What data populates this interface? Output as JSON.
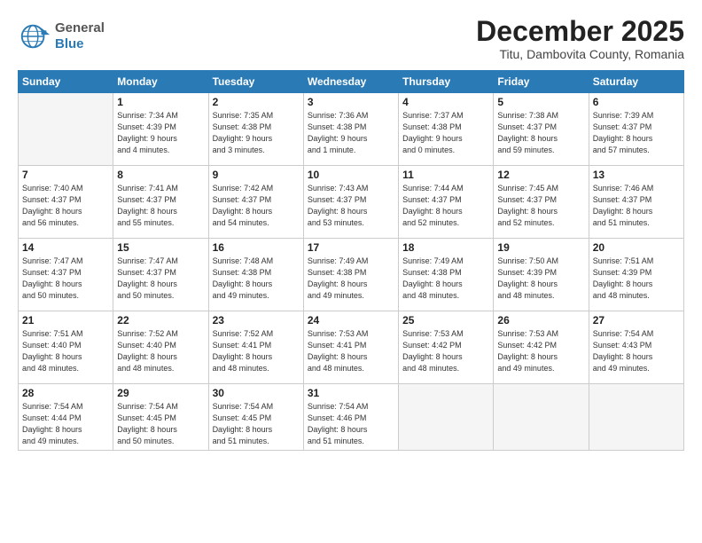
{
  "logo": {
    "general": "General",
    "blue": "Blue"
  },
  "title": "December 2025",
  "subtitle": "Titu, Dambovita County, Romania",
  "days_of_week": [
    "Sunday",
    "Monday",
    "Tuesday",
    "Wednesday",
    "Thursday",
    "Friday",
    "Saturday"
  ],
  "weeks": [
    [
      {
        "day": "",
        "info": ""
      },
      {
        "day": "1",
        "info": "Sunrise: 7:34 AM\nSunset: 4:39 PM\nDaylight: 9 hours\nand 4 minutes."
      },
      {
        "day": "2",
        "info": "Sunrise: 7:35 AM\nSunset: 4:38 PM\nDaylight: 9 hours\nand 3 minutes."
      },
      {
        "day": "3",
        "info": "Sunrise: 7:36 AM\nSunset: 4:38 PM\nDaylight: 9 hours\nand 1 minute."
      },
      {
        "day": "4",
        "info": "Sunrise: 7:37 AM\nSunset: 4:38 PM\nDaylight: 9 hours\nand 0 minutes."
      },
      {
        "day": "5",
        "info": "Sunrise: 7:38 AM\nSunset: 4:37 PM\nDaylight: 8 hours\nand 59 minutes."
      },
      {
        "day": "6",
        "info": "Sunrise: 7:39 AM\nSunset: 4:37 PM\nDaylight: 8 hours\nand 57 minutes."
      }
    ],
    [
      {
        "day": "7",
        "info": "Sunrise: 7:40 AM\nSunset: 4:37 PM\nDaylight: 8 hours\nand 56 minutes."
      },
      {
        "day": "8",
        "info": "Sunrise: 7:41 AM\nSunset: 4:37 PM\nDaylight: 8 hours\nand 55 minutes."
      },
      {
        "day": "9",
        "info": "Sunrise: 7:42 AM\nSunset: 4:37 PM\nDaylight: 8 hours\nand 54 minutes."
      },
      {
        "day": "10",
        "info": "Sunrise: 7:43 AM\nSunset: 4:37 PM\nDaylight: 8 hours\nand 53 minutes."
      },
      {
        "day": "11",
        "info": "Sunrise: 7:44 AM\nSunset: 4:37 PM\nDaylight: 8 hours\nand 52 minutes."
      },
      {
        "day": "12",
        "info": "Sunrise: 7:45 AM\nSunset: 4:37 PM\nDaylight: 8 hours\nand 52 minutes."
      },
      {
        "day": "13",
        "info": "Sunrise: 7:46 AM\nSunset: 4:37 PM\nDaylight: 8 hours\nand 51 minutes."
      }
    ],
    [
      {
        "day": "14",
        "info": "Sunrise: 7:47 AM\nSunset: 4:37 PM\nDaylight: 8 hours\nand 50 minutes."
      },
      {
        "day": "15",
        "info": "Sunrise: 7:47 AM\nSunset: 4:37 PM\nDaylight: 8 hours\nand 50 minutes."
      },
      {
        "day": "16",
        "info": "Sunrise: 7:48 AM\nSunset: 4:38 PM\nDaylight: 8 hours\nand 49 minutes."
      },
      {
        "day": "17",
        "info": "Sunrise: 7:49 AM\nSunset: 4:38 PM\nDaylight: 8 hours\nand 49 minutes."
      },
      {
        "day": "18",
        "info": "Sunrise: 7:49 AM\nSunset: 4:38 PM\nDaylight: 8 hours\nand 48 minutes."
      },
      {
        "day": "19",
        "info": "Sunrise: 7:50 AM\nSunset: 4:39 PM\nDaylight: 8 hours\nand 48 minutes."
      },
      {
        "day": "20",
        "info": "Sunrise: 7:51 AM\nSunset: 4:39 PM\nDaylight: 8 hours\nand 48 minutes."
      }
    ],
    [
      {
        "day": "21",
        "info": "Sunrise: 7:51 AM\nSunset: 4:40 PM\nDaylight: 8 hours\nand 48 minutes."
      },
      {
        "day": "22",
        "info": "Sunrise: 7:52 AM\nSunset: 4:40 PM\nDaylight: 8 hours\nand 48 minutes."
      },
      {
        "day": "23",
        "info": "Sunrise: 7:52 AM\nSunset: 4:41 PM\nDaylight: 8 hours\nand 48 minutes."
      },
      {
        "day": "24",
        "info": "Sunrise: 7:53 AM\nSunset: 4:41 PM\nDaylight: 8 hours\nand 48 minutes."
      },
      {
        "day": "25",
        "info": "Sunrise: 7:53 AM\nSunset: 4:42 PM\nDaylight: 8 hours\nand 48 minutes."
      },
      {
        "day": "26",
        "info": "Sunrise: 7:53 AM\nSunset: 4:42 PM\nDaylight: 8 hours\nand 49 minutes."
      },
      {
        "day": "27",
        "info": "Sunrise: 7:54 AM\nSunset: 4:43 PM\nDaylight: 8 hours\nand 49 minutes."
      }
    ],
    [
      {
        "day": "28",
        "info": "Sunrise: 7:54 AM\nSunset: 4:44 PM\nDaylight: 8 hours\nand 49 minutes."
      },
      {
        "day": "29",
        "info": "Sunrise: 7:54 AM\nSunset: 4:45 PM\nDaylight: 8 hours\nand 50 minutes."
      },
      {
        "day": "30",
        "info": "Sunrise: 7:54 AM\nSunset: 4:45 PM\nDaylight: 8 hours\nand 51 minutes."
      },
      {
        "day": "31",
        "info": "Sunrise: 7:54 AM\nSunset: 4:46 PM\nDaylight: 8 hours\nand 51 minutes."
      },
      {
        "day": "",
        "info": ""
      },
      {
        "day": "",
        "info": ""
      },
      {
        "day": "",
        "info": ""
      }
    ]
  ]
}
